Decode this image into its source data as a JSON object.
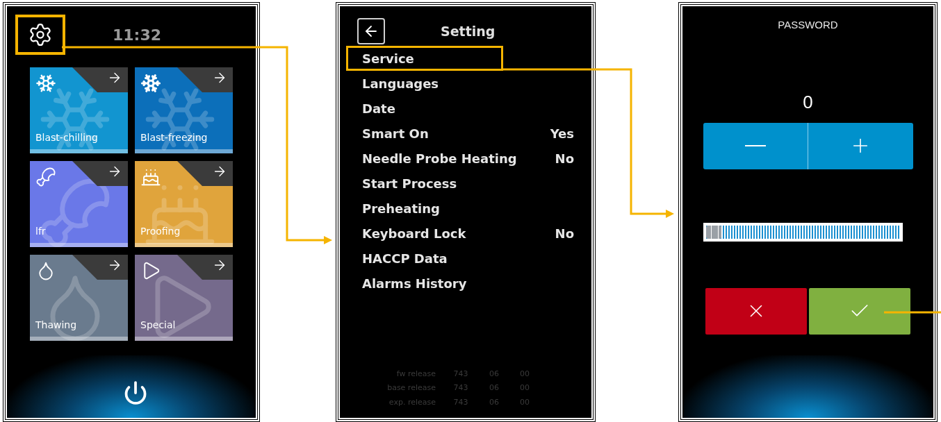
{
  "home_screen": {
    "settings_button": {
      "highlighted": true
    },
    "time": "11:32",
    "tiles": [
      {
        "kind": "chill",
        "label": "Blast-chilling",
        "color": "#1295d0"
      },
      {
        "kind": "freeze",
        "label": "Blast-freezing",
        "color": "#0c6fba"
      },
      {
        "kind": "lfr",
        "label": "lfr",
        "color": "#6a78e8"
      },
      {
        "kind": "proofing",
        "label": "Proofing",
        "color": "#e0a43c"
      },
      {
        "kind": "thawing",
        "label": "Thawing",
        "color": "#6a7b8e"
      },
      {
        "kind": "special",
        "label": "Special",
        "color": "#756a8c"
      }
    ]
  },
  "setting_screen": {
    "title": "Setting",
    "items": [
      {
        "label": "Service",
        "highlighted": true
      },
      {
        "label": "Languages",
        "highlighted": false
      },
      {
        "label": "Date",
        "highlighted": false
      },
      {
        "label": "Smart On",
        "value": "Yes",
        "highlighted": false
      },
      {
        "label": "Needle Probe Heating",
        "value": "No",
        "highlighted": false
      },
      {
        "label": "Start Process",
        "highlighted": false
      },
      {
        "label": "Preheating",
        "highlighted": false
      },
      {
        "label": "Keyboard Lock",
        "value": "No",
        "highlighted": false
      },
      {
        "label": "HACCP Data",
        "highlighted": false
      },
      {
        "label": "Alarms History",
        "highlighted": false
      }
    ],
    "releases": [
      {
        "label": "fw release",
        "values": [
          "743",
          "06",
          "00"
        ]
      },
      {
        "label": "base release",
        "values": [
          "743",
          "06",
          "00"
        ]
      },
      {
        "label": "exp. release",
        "values": [
          "743",
          "06",
          "00"
        ]
      }
    ]
  },
  "password_screen": {
    "title": "PASSWORD",
    "value": "0",
    "slider": {
      "level": 0
    }
  }
}
